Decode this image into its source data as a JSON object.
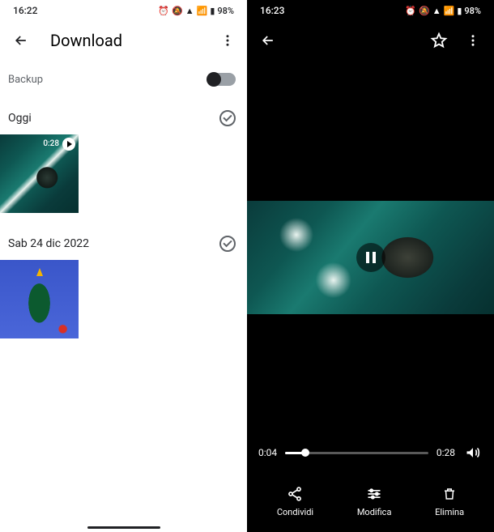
{
  "left": {
    "status": {
      "time": "16:22",
      "battery": "98%"
    },
    "title": "Download",
    "backup_label": "Backup",
    "sections": [
      {
        "label": "Oggi",
        "thumb": {
          "kind": "ocean",
          "duration": "0:28"
        }
      },
      {
        "label": "Sab 24 dic 2022",
        "thumb": {
          "kind": "tree"
        }
      }
    ]
  },
  "right": {
    "status": {
      "time": "16:23",
      "battery": "98%"
    },
    "playback": {
      "current": "0:04",
      "total": "0:28"
    },
    "actions": {
      "share": "Condividi",
      "edit": "Modifica",
      "delete": "Elimina"
    }
  }
}
